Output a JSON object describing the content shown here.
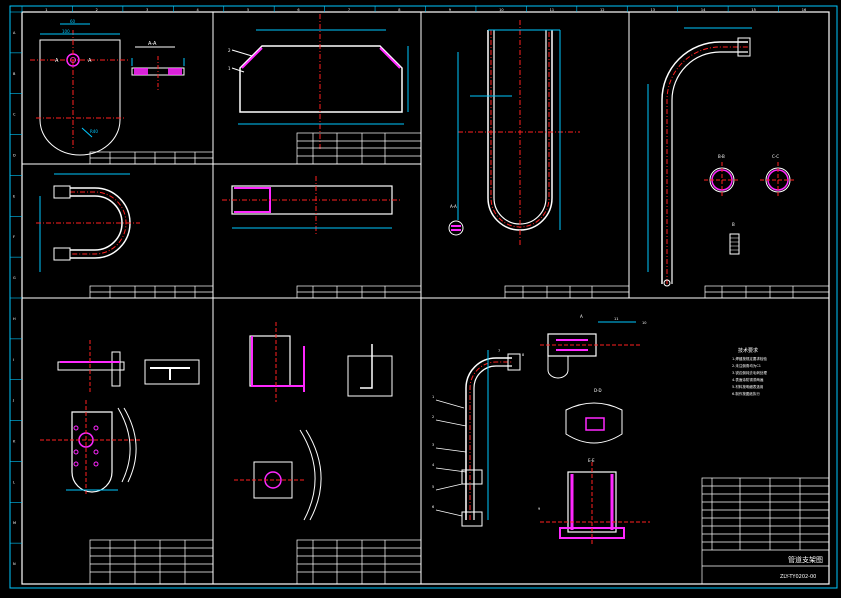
{
  "sheet": {
    "background": "#000000",
    "line_white": "#ffffff",
    "line_cyan": "#00c8ff",
    "line_blue": "#2a3cff",
    "line_red": "#ff2020",
    "line_magenta": "#ff28ff",
    "line_green": "#00ff40",
    "top_ruler": [
      "1",
      "2",
      "3",
      "4",
      "5",
      "6",
      "7",
      "8",
      "9",
      "10",
      "11",
      "12",
      "13",
      "14",
      "15",
      "16"
    ],
    "side_ruler": [
      "A",
      "B",
      "C",
      "D",
      "E",
      "F",
      "G",
      "H",
      "I",
      "J",
      "K",
      "L",
      "M",
      "N"
    ]
  },
  "views": {
    "section_aa": "A-A",
    "section_bb": "B-B",
    "section_cc": "C-C",
    "section_dd": "D-D",
    "section_ee": "E-E",
    "view_a": "A",
    "view_b": "B"
  },
  "tech_requirements": {
    "title": "技术要求",
    "lines": [
      "1.焊缝按规定要求检验",
      "2.未注倒角均为C1",
      "3.锐边倒钝去毛刺处理",
      "4.表面涂防锈漆两遍",
      "5.材料按明细表选用",
      "6.制作按图纸执行"
    ]
  },
  "main_title": {
    "name": "管道支架图",
    "drawing_no": "ZLY-TY0202-00"
  },
  "balloons": [
    "1",
    "2",
    "3",
    "4",
    "5",
    "6",
    "7",
    "8",
    "9",
    "10",
    "11"
  ]
}
